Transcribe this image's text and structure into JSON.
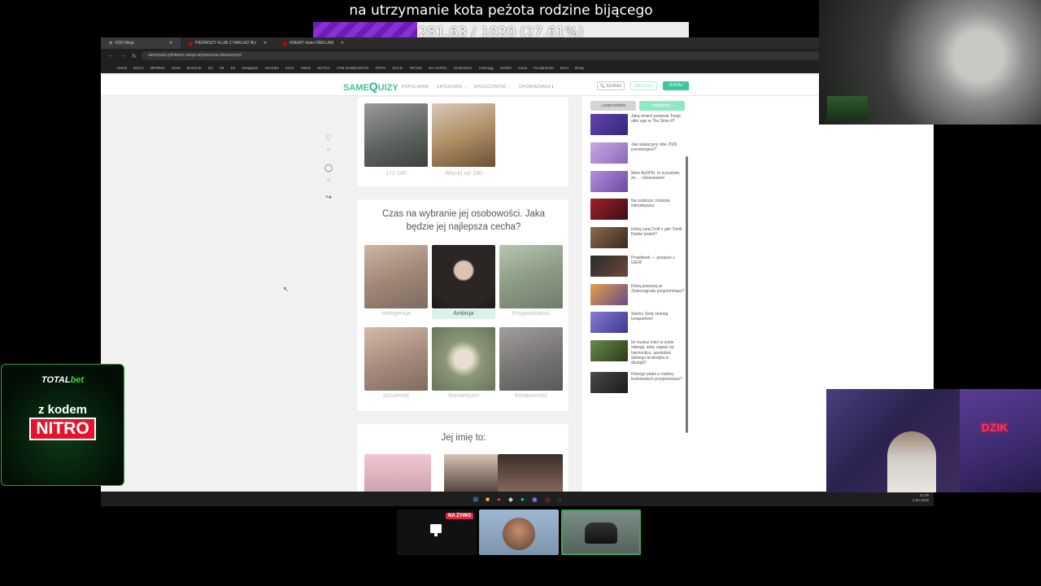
{
  "overlay": {
    "title": "na utrzymanie kota peżota rodzine bijącego",
    "progress_text": "281.63 / 1020 (27.61%)",
    "progress_fraction": 0.2761
  },
  "browser": {
    "tabs": [
      "VOD.Ninja",
      "PIERWSZY KLUB Z NAKLAD NU",
      "KREMY dzieci REKLAM"
    ],
    "url": "samequizy.pl/stworz-swoja-wymarzona-dziewczyne/",
    "bookmarks": [
      "Gmail",
      "DOCS",
      "WFIRMA",
      "SOW",
      "BALDUK",
      "G4",
      "FB",
      "FE",
      "Instagram",
      "YouTube",
      "KICK",
      "Twitch",
      "BOTKA",
      "UTM RAMELIENTS",
      "TIPSY",
      "SACD",
      "TIKTOK",
      "NA HAPSA",
      "GIVEAWAY",
      "zohmagy",
      "NAPD!",
      "muza",
      "Pocialnmeto",
      "herni",
      "dmep"
    ]
  },
  "site": {
    "logo_a": "SAME",
    "logo_b": "Q",
    "logo_c": "UIZY",
    "menu": [
      "POPULARNE",
      "KATEGORIE ⌵",
      "SPOŁECZNOŚĆ ⌵",
      "OPOWIADANIA ℹ"
    ],
    "search": "🔍 SZUKAJ",
    "login": "ZALOGUJ",
    "add": "DODAJ"
  },
  "side_counts": [
    "66",
    "16"
  ],
  "card1": {
    "captions": [
      "171-180",
      "Więcej niż 180"
    ]
  },
  "card2": {
    "question": "Czas na wybranie jej osobowości. Jaka będzie jej najlepsza cecha?",
    "options": [
      "Inteligencja",
      "Ambicja",
      "Przyjacielskość",
      "Szczerość",
      "Romantyzm",
      "Kreatywność"
    ],
    "selected": "Ambicja"
  },
  "card3": {
    "question": "Jej imię to:"
  },
  "sidebar": {
    "prev": "‹ poprzednie",
    "next": "następny ›",
    "items": [
      "Jaką śmierć poniesie Twoje alter ego w The Sims 4?",
      "Jaki wakacyjny vibe 2026 prezentujesz?",
      "Mam AuDHD, to oczywiste, że... - Głosowanie!",
      "Na rozdrożu | historia interaktywna",
      "Którą Larą Croft z gier Tomb Raider jesteś?",
      "Projektnek — postacie z GIER!",
      "Którą postacią ze Zwierzogrodu przypominasz?",
      "Stwórz Swój ranking lunaparków!",
      "Ile musisz mieć w sobie odwagi, żeby zagrać na harmonijce, upodobać dzikiego krokodyla w dzuńgli?",
      "Którego ptaka z rodziny krukowatych przypominasz?"
    ]
  },
  "tray": {
    "time": "21:59",
    "date": "2.06.2026"
  },
  "ad": {
    "brand_a": "TOTAL",
    "brand_b": "bet",
    "kod": "z kodem",
    "nitro": "NITRO"
  },
  "live_badge": "NA ŻYWO",
  "colors": {
    "accent": "#3ec59a",
    "progress_purple": "#6b1fb0"
  }
}
